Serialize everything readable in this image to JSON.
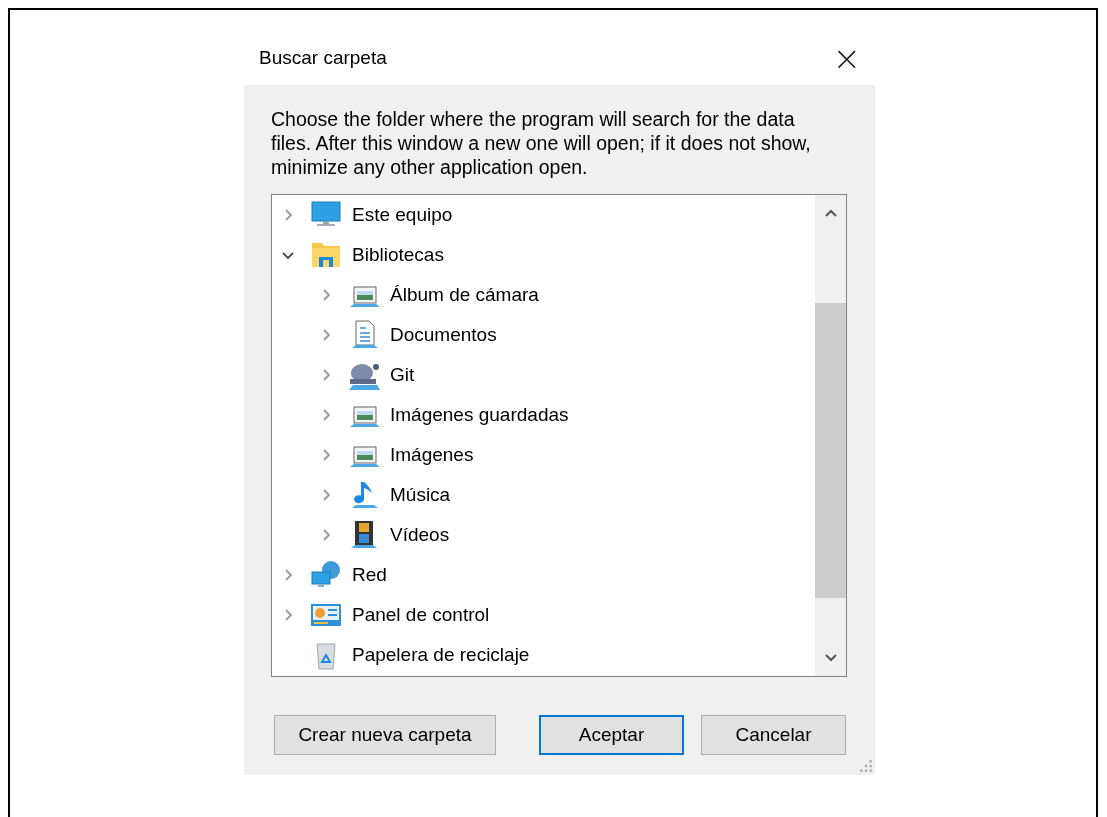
{
  "window": {
    "title": "Buscar carpeta",
    "close": "×"
  },
  "instructions": "Choose the folder where the program will search for the data files. After this window a new one will open; if it does not show, minimize any other application open.",
  "tree": [
    {
      "label": "Este equipo",
      "kind": "computer",
      "expanded": false
    },
    {
      "label": "Bibliotecas",
      "kind": "library",
      "expanded": true,
      "children": [
        {
          "label": "Álbum de cámara",
          "kind": "picture-lib",
          "expanded": false
        },
        {
          "label": "Documentos",
          "kind": "document",
          "expanded": false
        },
        {
          "label": "Git",
          "kind": "git",
          "expanded": false
        },
        {
          "label": "Imágenes guardadas",
          "kind": "picture-lib",
          "expanded": false
        },
        {
          "label": "Imágenes",
          "kind": "picture-lib",
          "expanded": false
        },
        {
          "label": "Música",
          "kind": "music",
          "expanded": false
        },
        {
          "label": "Vídeos",
          "kind": "video",
          "expanded": false
        }
      ]
    },
    {
      "label": "Red",
      "kind": "network",
      "expanded": false
    },
    {
      "label": "Panel de control",
      "kind": "control-panel",
      "expanded": false
    },
    {
      "label": "Papelera de reciclaje",
      "kind": "recycle-bin"
    }
  ],
  "buttons": [
    {
      "label": "Crear nueva carpeta",
      "kind": "secondary"
    },
    {
      "label": "Aceptar",
      "kind": "default"
    },
    {
      "label": "Cancelar",
      "kind": "secondary"
    }
  ]
}
